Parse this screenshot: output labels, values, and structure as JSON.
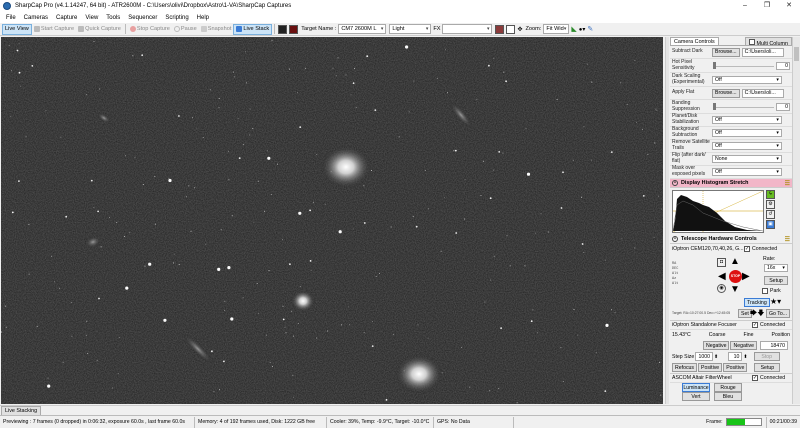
{
  "window": {
    "title": "SharpCap Pro (v4.1.14247, 64 bit) - ATR2600M - C:\\Users\\olivi\\Dropbox\\Astro\\1-VA\\SharpCap Captures",
    "minimize": "–",
    "maximize": "❐",
    "close": "✕"
  },
  "menu": [
    "File",
    "Cameras",
    "Capture",
    "View",
    "Tools",
    "Sequencer",
    "Scripting",
    "Help"
  ],
  "toolbar": {
    "live_view": "Live View",
    "start_capture": "Start Capture",
    "quick_capture": "Quick Capture",
    "stop_capture": "Stop Capture",
    "pause": "Pause",
    "snapshot": "Snapshot",
    "live_stack": "Live Stack",
    "target_name_label": "Target Name :",
    "target_name_value": "CM7 2600M L",
    "frame_type": "Light",
    "fx_label": "FX",
    "fx_value": "",
    "zoom_label": "Zoom:",
    "zoom_value": "Fit Wid"
  },
  "panel": {
    "tab_camera_controls": "Camera Controls",
    "tab_multi_column": "Multi Column",
    "subtract_dark_label": "Subtract Dark",
    "subtract_dark_browse": "Browse...",
    "subtract_dark_path": "C:\\Users\\oli...",
    "hot_pixel_label": "Hot Pixel Sensitivity",
    "hot_pixel_value": "0",
    "dark_scaling_label": "Dark Scaling (Experimental)",
    "dark_scaling_value": "Off",
    "apply_flat_label": "Apply Flat",
    "apply_flat_browse": "Browse...",
    "apply_flat_path": "C:\\Users\\oli...",
    "banding_label": "Banding Suppression",
    "banding_value": "0",
    "planet_disk_label": "Planet/Disk Stabilization",
    "planet_disk_value": "Off",
    "background_sub_label": "Background Subtraction",
    "background_sub_value": "Off",
    "remove_satellite_label": "Remove Satellite Trails",
    "remove_satellite_value": "Off",
    "flip_label": "Flip (after dark/ flat)",
    "flip_value": "None",
    "mask_label": "Mask over exposed pixels",
    "mask_value": "Off",
    "histogram_title": "Display Histogram Stretch",
    "telescope_title": "Telescope Hardware Controls",
    "mount_name": "iOptron CEM120,70,40,26, G...",
    "connected_label": "Connected",
    "rate_label": "Rate:",
    "rate_value": "16x",
    "setup_label": "Setup",
    "park_label": "Park",
    "stop_label": "STOP",
    "tracking_label": "Tracking",
    "set_label": "Set",
    "goto_label": "Go To...",
    "coords": [
      "RA",
      "DEC",
      "Alt",
      "Az",
      "Alt"
    ],
    "target_line": "Target: RA=10:27:00.5 Dec=+12:45:05",
    "focuser_name": "iOptron Standalone Focuser",
    "focuser_connected": "Connected",
    "focuser_temp": "15.43°C",
    "coarse_label": "Coarse",
    "fine_label": "Fine",
    "position_label": "Position",
    "negative_label": "Negative",
    "negative_label2": "Negative",
    "position_value": "18470",
    "step_size_label": "Step Size",
    "step_size_value": "1000",
    "step_fine_value": "10",
    "stop_focuser": "Stop",
    "refocus_label": "Refocus",
    "positive_label": "Positive",
    "positive_label2": "Positive",
    "setup2_label": "Setup",
    "filter_name": "ASCOM Altair FilterWheel",
    "filter_connected": "Connected",
    "filters": [
      "Luminance",
      "Rouge",
      "Vert",
      "Bleu"
    ]
  },
  "bottom": {
    "live_stacking_tab": "Live Stacking",
    "status_preview": "Previewing : 7 frames (0 dropped) in 0:06:32, exposure 60.0s , last frame 60.0s",
    "status_memory": "Memory: 4 of 192 frames used, Disk: 1222 GB free",
    "status_cooler": "Cooler: 39%, Temp: -9.9°C, Target: -10.0°C",
    "status_gps": "GPS: No Data",
    "frame_label": "Frame:",
    "frame_time": "00:21/00:39",
    "frame_progress": 0.55
  }
}
